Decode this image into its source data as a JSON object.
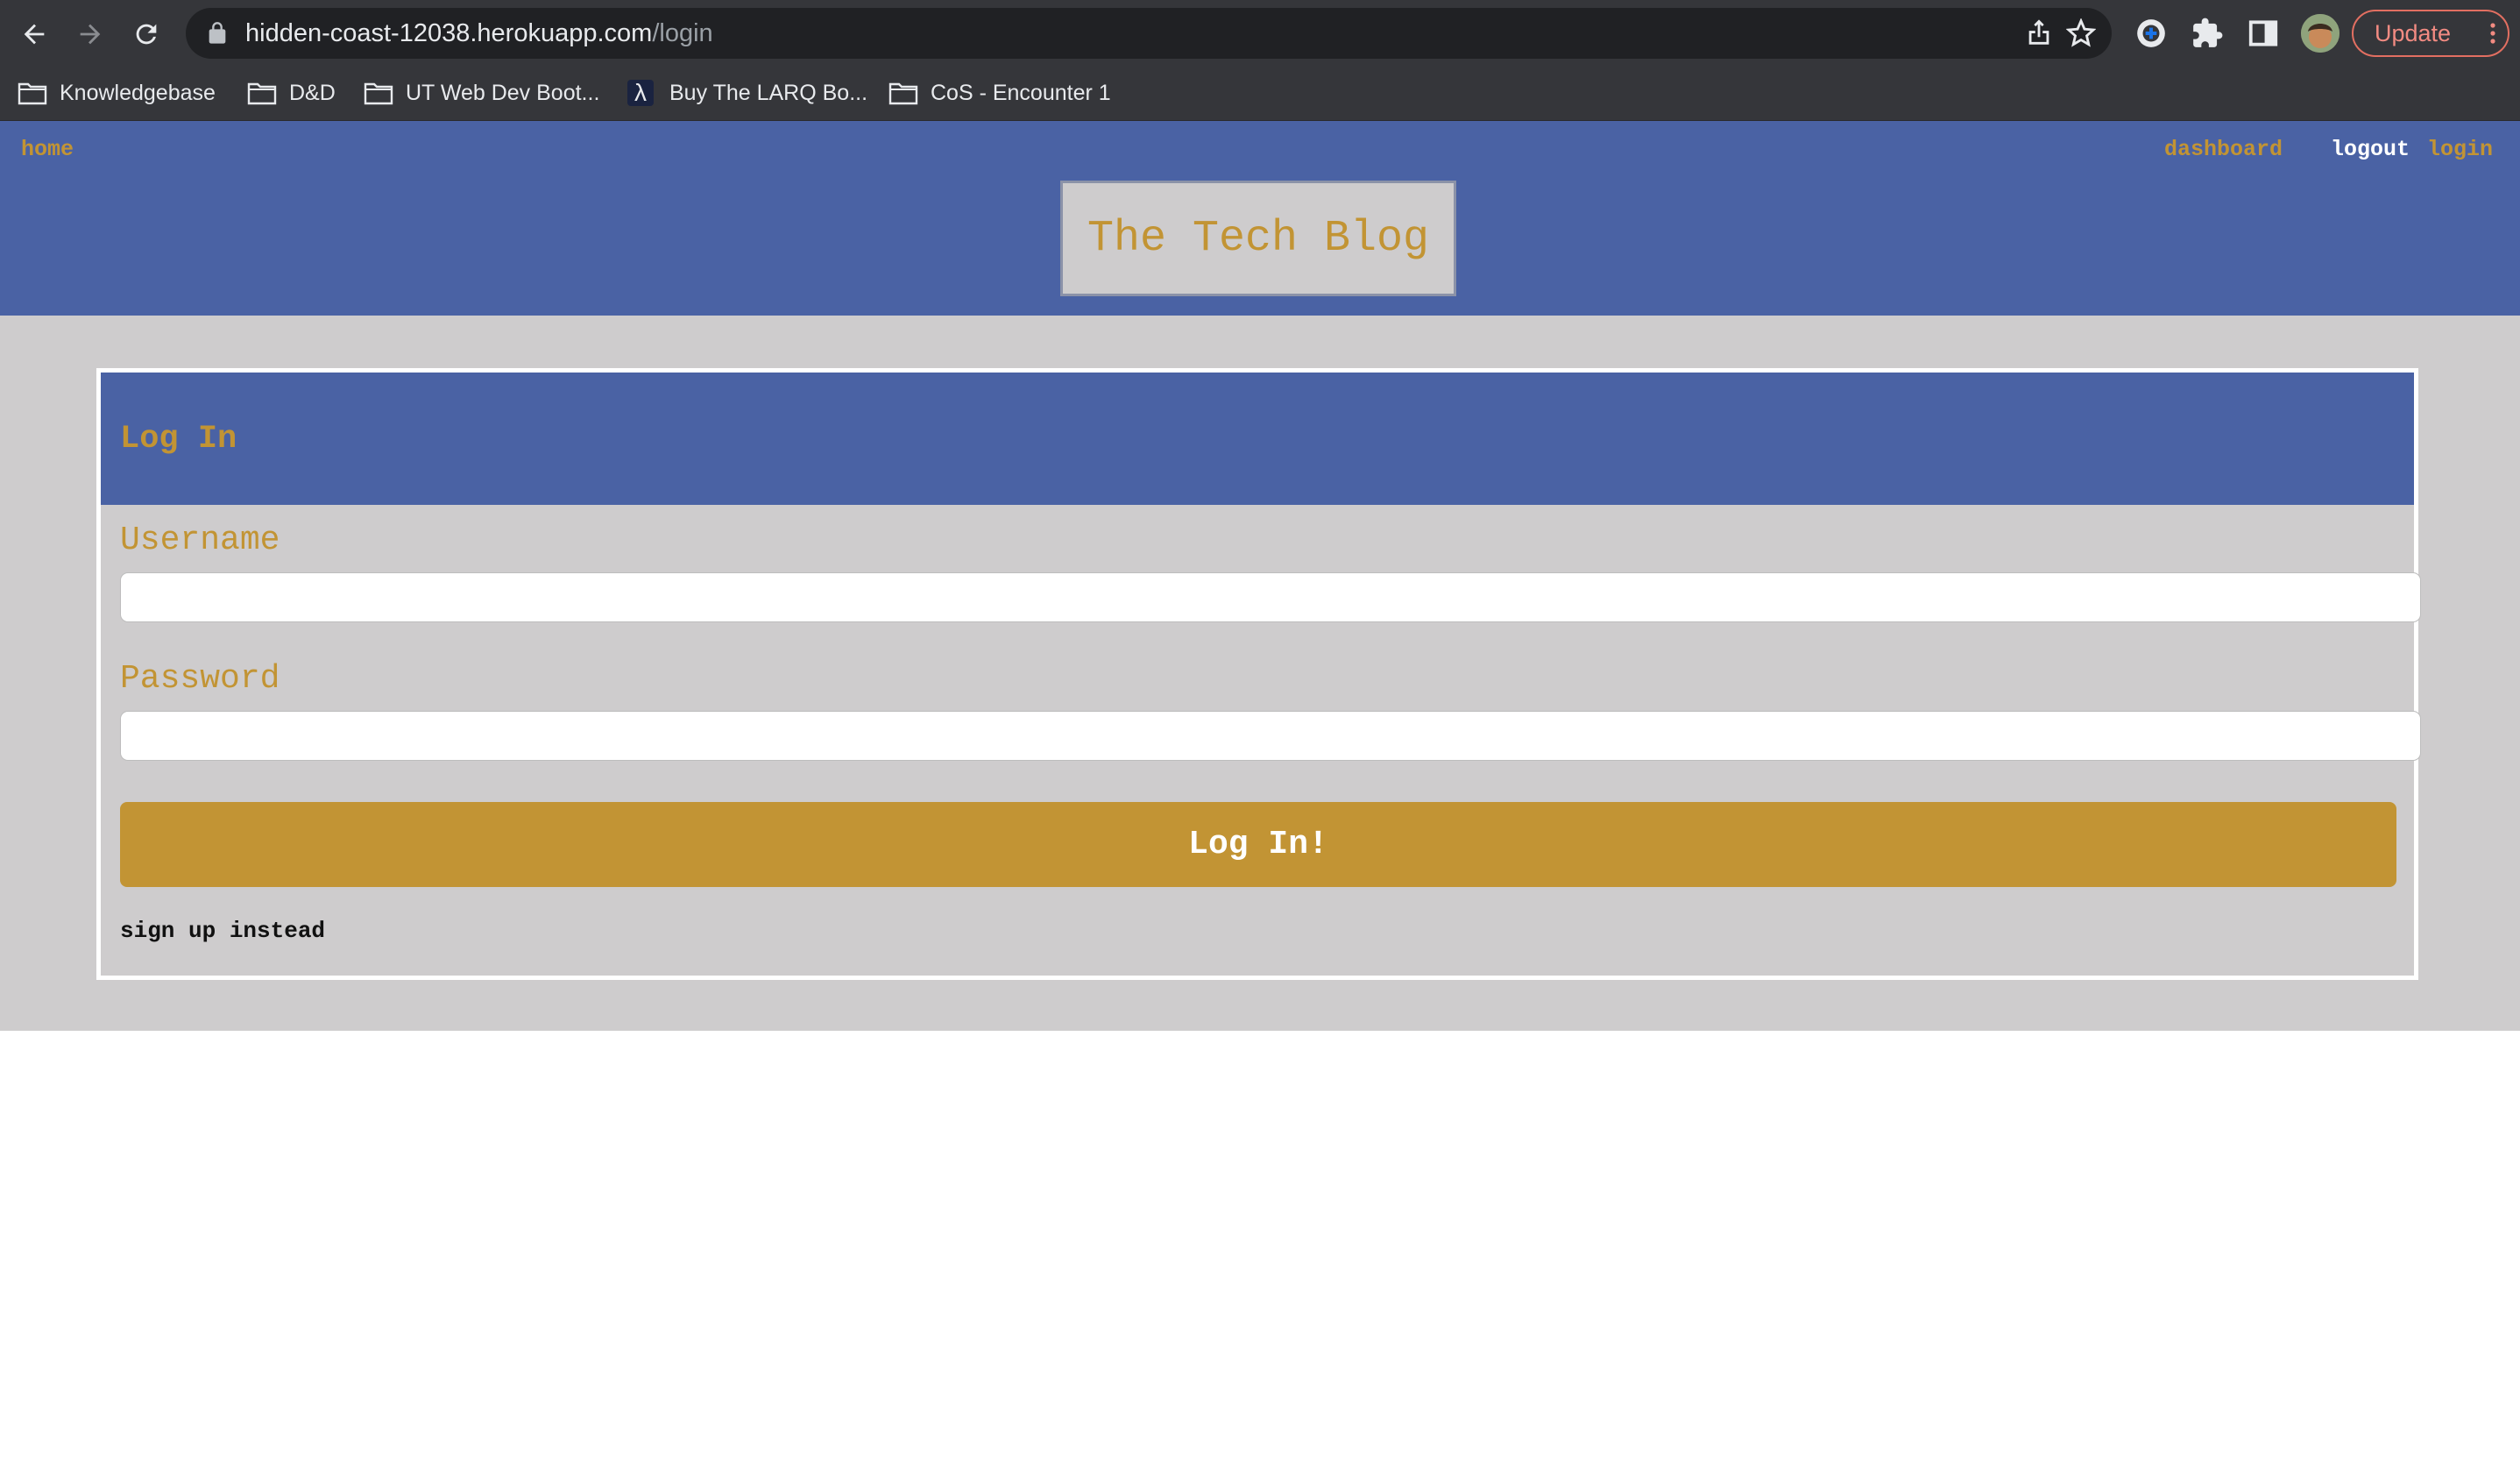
{
  "browser": {
    "url_host": "hidden-coast-12038.herokuapp.com",
    "url_path": "/login",
    "update_label": "Update",
    "icons": [
      "back-arrow-icon",
      "forward-arrow-icon",
      "reload-icon",
      "lock-icon",
      "share-icon",
      "star-icon",
      "password-manager-icon",
      "extensions-icon",
      "side-panel-icon",
      "profile-avatar",
      "more-vert-icon"
    ]
  },
  "bookmarks": [
    {
      "label": "Knowledgebase",
      "icon": "folder-icon"
    },
    {
      "label": "D&D",
      "icon": "folder-icon"
    },
    {
      "label": "UT Web Dev Boot...",
      "icon": "folder-icon"
    },
    {
      "label": "Buy The LARQ Bo...",
      "icon": "lambda-icon"
    },
    {
      "label": "CoS - Encounter 1",
      "icon": "folder-icon"
    }
  ],
  "site": {
    "nav": {
      "home": "home",
      "dashboard": "dashboard",
      "logout": "logout",
      "login": "login"
    },
    "title": "The Tech Blog",
    "colors": {
      "header": "#4a62a4",
      "accent": "#c29434",
      "background": "#cecccd"
    }
  },
  "login_form": {
    "heading": "Log In",
    "username_label": "Username",
    "username_value": "",
    "password_label": "Password",
    "password_value": "",
    "submit_label": "Log In!",
    "signup_link": "sign up instead"
  }
}
